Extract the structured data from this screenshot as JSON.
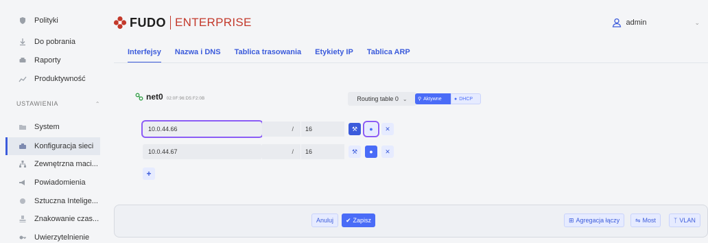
{
  "sidebar": {
    "items_top": [
      {
        "label": "Polityki",
        "icon": "shield-icon"
      },
      {
        "label": "Do pobrania",
        "icon": "download-icon"
      },
      {
        "label": "Raporty",
        "icon": "print-icon"
      },
      {
        "label": "Produktywność",
        "icon": "chart-icon"
      }
    ],
    "section_label": "USTAWIENIA",
    "items_settings": [
      {
        "label": "System",
        "icon": "folder-icon"
      },
      {
        "label": "Konfiguracja sieci",
        "icon": "network-icon"
      },
      {
        "label": "Zewnętrzna maci...",
        "icon": "sitemap-icon"
      },
      {
        "label": "Powiadomienia",
        "icon": "megaphone-icon"
      },
      {
        "label": "Sztuczna Intelige...",
        "icon": "brain-icon"
      },
      {
        "label": "Znakowanie czas...",
        "icon": "stamp-icon"
      },
      {
        "label": "Uwierzytelnienie",
        "icon": "key-icon"
      }
    ]
  },
  "header": {
    "brand": "FUDO",
    "edition": "ENTERPRISE",
    "user": "admin"
  },
  "tabs": [
    "Interfejsy",
    "Nazwa i DNS",
    "Tablica trasowania",
    "Etykiety IP",
    "Tablica ARP"
  ],
  "interface": {
    "name": "net0",
    "mac": "02:0F:96:D5:F2:0B",
    "routing_table": "Routing table 0",
    "active_label": "Aktywne",
    "dhcp_label": "DHCP"
  },
  "addresses": [
    {
      "ip": "10.0.44.66",
      "slash": "/",
      "prefix": "16"
    },
    {
      "ip": "10.0.44.67",
      "slash": "/",
      "prefix": "16"
    }
  ],
  "footer": {
    "cancel": "Anuluj",
    "save": "Zapisz",
    "aggregation": "Agregacja łączy",
    "bridge": "Most",
    "vlan": "VLAN"
  },
  "colors": {
    "accent": "#4a6cf7",
    "brand_red": "#c3392b",
    "highlight": "#8b5cf6"
  }
}
